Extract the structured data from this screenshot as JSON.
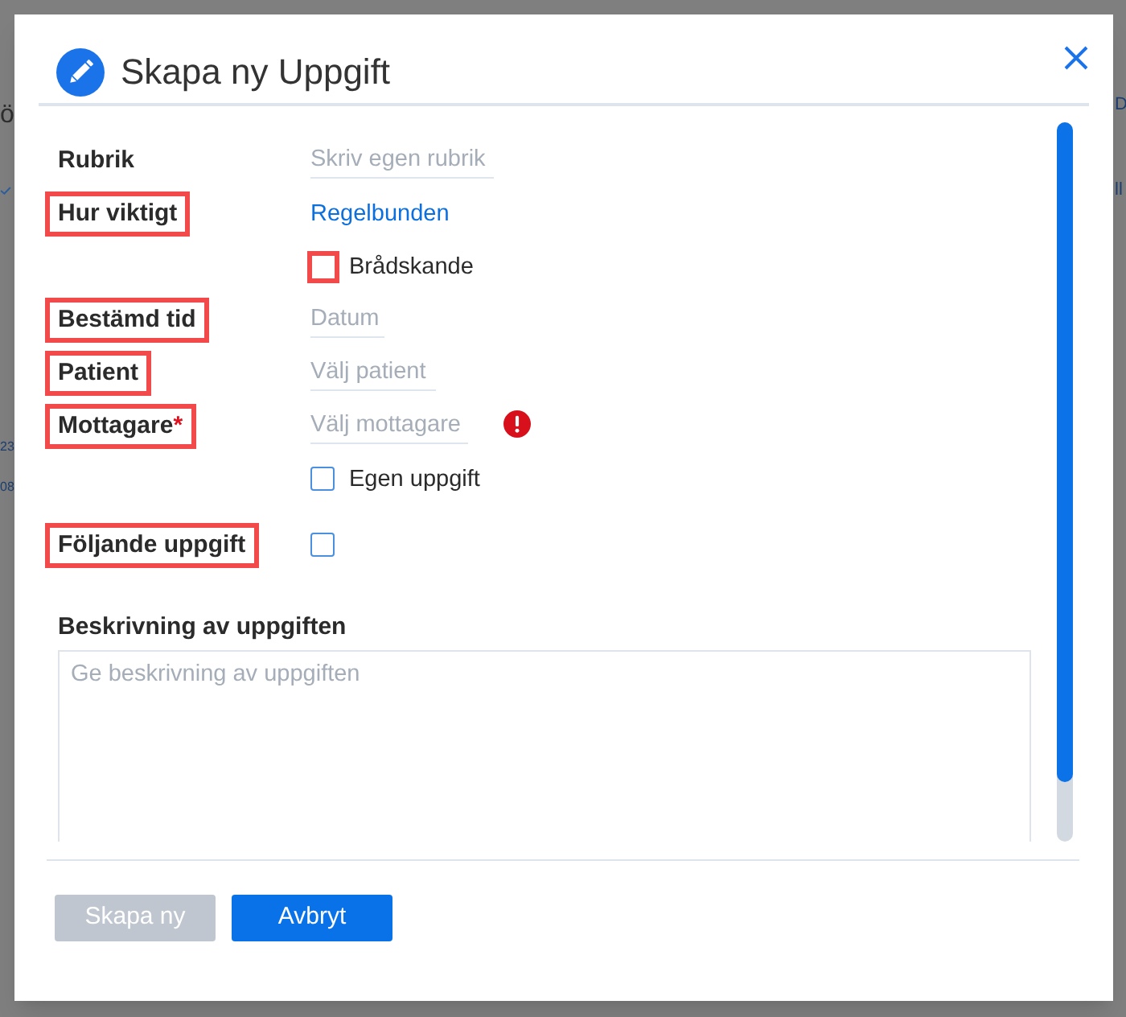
{
  "background_page": {
    "left_texts": [
      "ö",
      "23",
      "08"
    ],
    "right_texts": [
      "D",
      "ll"
    ]
  },
  "dialog": {
    "title": "Skapa ny Uppgift",
    "rows": [
      {
        "label": "Rubrik",
        "highlighted": false,
        "control": {
          "kind": "input",
          "placeholder": "Skriv egen rubrik"
        }
      },
      {
        "label": "Hur viktigt",
        "highlighted": true,
        "control": {
          "kind": "link",
          "text": "Regelbunden"
        }
      },
      {
        "control": {
          "kind": "checkbox",
          "text": "Brådskande",
          "checked": false,
          "highlighted": true
        }
      },
      {
        "label": "Bestämd tid",
        "highlighted": true,
        "control": {
          "kind": "input",
          "placeholder": "Datum"
        }
      },
      {
        "label": "Patient",
        "highlighted": true,
        "control": {
          "kind": "input",
          "placeholder": "Välj patient"
        }
      },
      {
        "label": "Mottagare",
        "required_mark": "*",
        "highlighted": true,
        "control": {
          "kind": "input",
          "placeholder": "Välj mottagare",
          "error": true
        }
      },
      {
        "control": {
          "kind": "checkbox",
          "text": "Egen uppgift",
          "checked": false,
          "highlighted": false
        }
      },
      {
        "label": "Följande uppgift",
        "highlighted": true,
        "control": {
          "kind": "checkbox",
          "checked": false,
          "highlighted": false
        }
      }
    ],
    "description": {
      "label": "Beskrivning av uppgiften",
      "placeholder": "Ge beskrivning av uppgiften"
    },
    "buttons": [
      {
        "label": "Skapa ny",
        "disabled": true
      },
      {
        "label": "Avbryt",
        "disabled": false
      }
    ]
  }
}
